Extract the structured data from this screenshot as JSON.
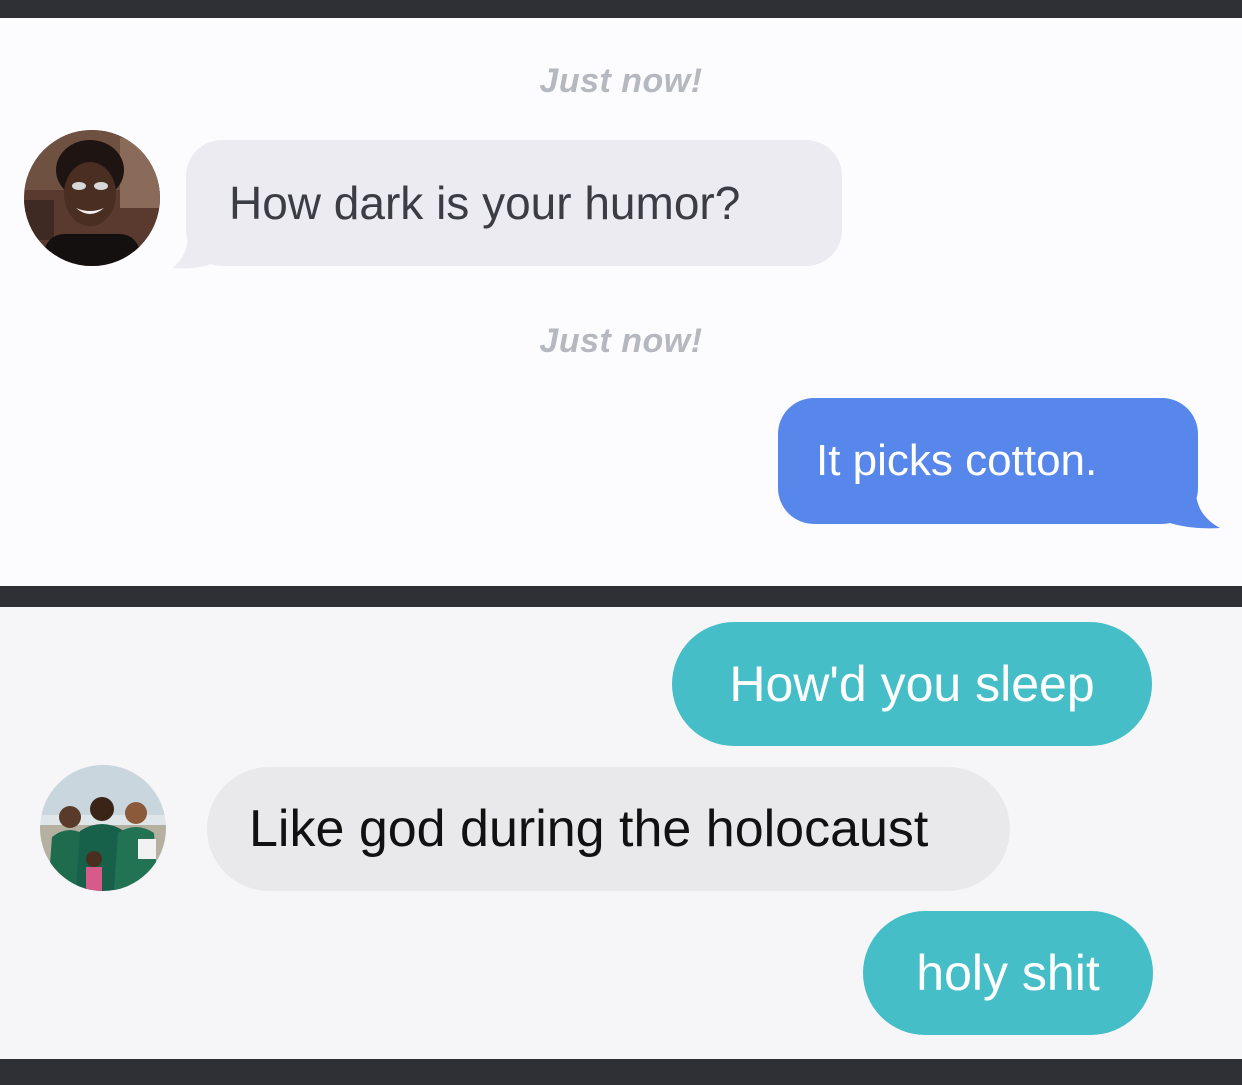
{
  "conversation_1": {
    "timestamps": [
      "Just now!",
      "Just now!"
    ],
    "incoming_message": "How dark is your humor?",
    "outgoing_message": "It picks cotton.",
    "colors": {
      "incoming_bubble": "#ebebf1",
      "outgoing_bubble": "#5887eb",
      "timestamp_text": "#b6b8c0"
    }
  },
  "conversation_2": {
    "outgoing_message_1": "How'd you sleep",
    "incoming_message": "Like god during the holocaust",
    "outgoing_message_2": "holy shit",
    "colors": {
      "incoming_bubble": "#e9e9eb",
      "outgoing_bubble": "#46bec8"
    }
  },
  "avatars": [
    {
      "icon": "profile-photo-avatar"
    },
    {
      "icon": "group-photo-avatar"
    }
  ]
}
